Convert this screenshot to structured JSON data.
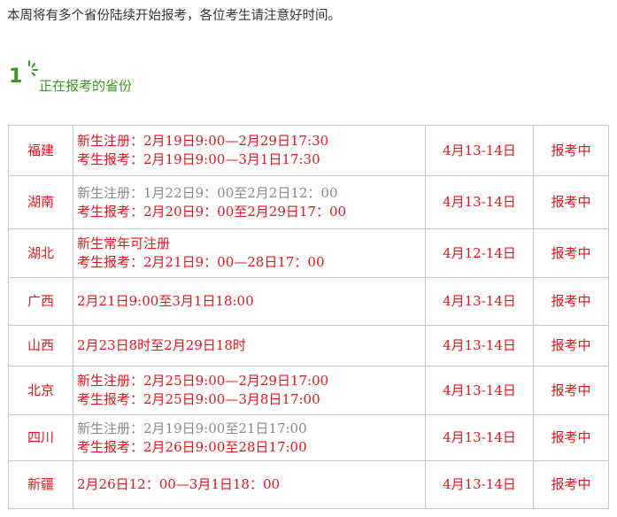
{
  "intro": "本周将有多个省份陆续开始报考，各位考生请注意好时间。",
  "section": {
    "number": "1",
    "title": "正在报考的省份"
  },
  "colors": {
    "accent_green": "#3a9a1f",
    "red": "#e8141b",
    "gray": "#8a8a8a",
    "border": "#c8c8c8"
  },
  "rows": [
    {
      "province": "福建",
      "lines": [
        {
          "text": "新生注册：2月19日9:00—2月29日17:30",
          "tone": "red"
        },
        {
          "text": "考生报考：2月19日9:00—3月1日17:30",
          "tone": "red"
        }
      ],
      "exam_date": "4月13-14日",
      "status": "报考中"
    },
    {
      "province": "湖南",
      "lines": [
        {
          "text": "新生注册：1月22日9：00至2月2日12：00",
          "tone": "gray"
        },
        {
          "text": "考生报考：2月20日9：00至2月29日17：00",
          "tone": "red"
        }
      ],
      "exam_date": "4月13-14日",
      "status": "报考中"
    },
    {
      "province": "湖北",
      "lines": [
        {
          "text": "新生常年可注册",
          "tone": "red"
        },
        {
          "text": "考生报考：2月21日9：00—28日17：00",
          "tone": "red"
        }
      ],
      "exam_date": "4月12-14日",
      "status": "报考中"
    },
    {
      "province": "广西",
      "lines": [
        {
          "text": "2月21日9:00至3月1日18:00",
          "tone": "red"
        }
      ],
      "exam_date": "4月13-14日",
      "status": "报考中"
    },
    {
      "province": "山西",
      "lines": [
        {
          "text": "2月23日8时至2月29日18时",
          "tone": "red"
        }
      ],
      "exam_date": "4月13-14日",
      "status": "报考中"
    },
    {
      "province": "北京",
      "lines": [
        {
          "text": "新生注册：2月25日9:00—2月29日17:00",
          "tone": "red"
        },
        {
          "text": "考生报考：2月25日9:00—3月8日17:00",
          "tone": "red"
        }
      ],
      "exam_date": "4月13-14日",
      "status": "报考中"
    },
    {
      "province": "四川",
      "lines": [
        {
          "text": "新生注册：2月19日9:00至21日17:00",
          "tone": "gray"
        },
        {
          "text": "考生报考：2月26日9:00至28日17:00",
          "tone": "red"
        }
      ],
      "exam_date": "4月13-14日",
      "status": "报考中"
    },
    {
      "province": "新疆",
      "lines": [
        {
          "text": "2月26日12：00—3月1日18：00",
          "tone": "red"
        }
      ],
      "exam_date": "4月13-14日",
      "status": "报考中"
    }
  ]
}
